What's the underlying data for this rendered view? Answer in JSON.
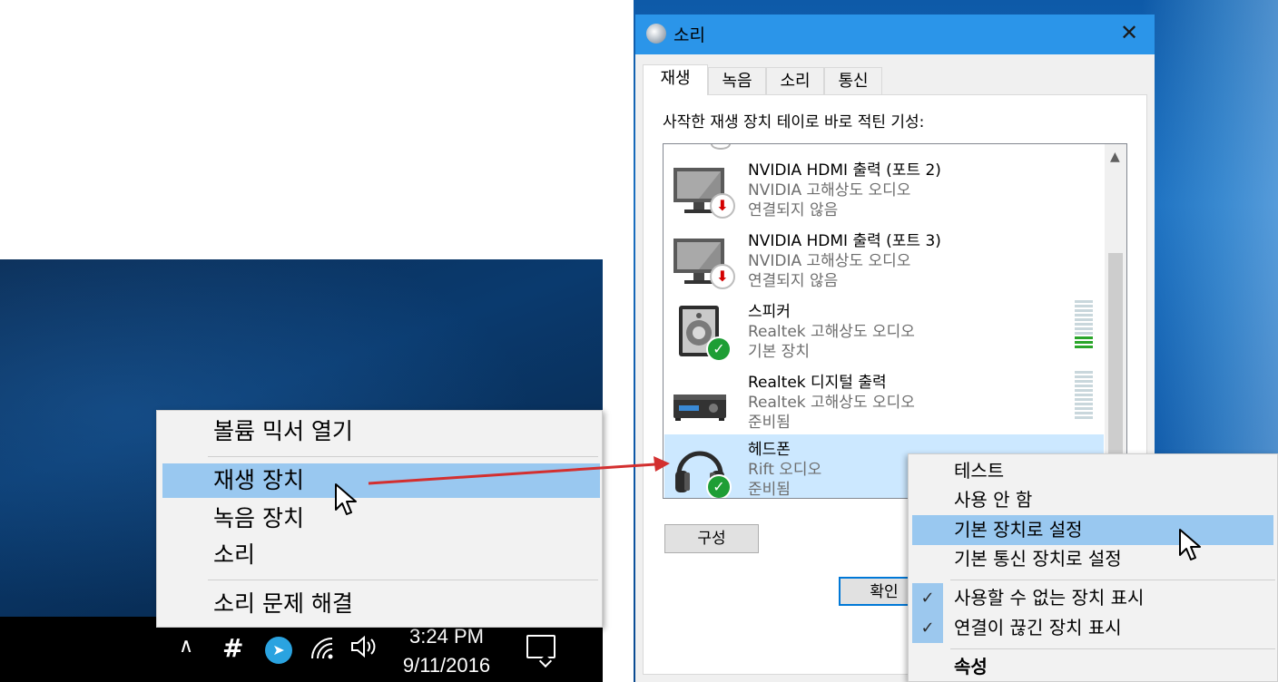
{
  "tray_menu": {
    "items": [
      {
        "label": "볼륨 믹서 열기"
      },
      {
        "label": "재생 장치"
      },
      {
        "label": "녹음 장치"
      },
      {
        "label": "소리"
      },
      {
        "label": "소리 문제 해결"
      }
    ],
    "highlighted_index": 1
  },
  "taskbar": {
    "time": "3:24 PM",
    "date": "9/11/2016",
    "icons": [
      "chevron-up-icon",
      "slack-icon",
      "telegram-icon",
      "wifi-icon",
      "volume-icon",
      "notification-icon"
    ]
  },
  "dialog": {
    "title": "소리",
    "close_glyph": "✕",
    "tabs": [
      {
        "label": "재생",
        "active": true
      },
      {
        "label": "녹음",
        "active": false
      },
      {
        "label": "소리",
        "active": false
      },
      {
        "label": "통신",
        "active": false
      }
    ],
    "instruction": "사작한 재생 장치 테이로 바로 적틴 기성:",
    "devices": [
      {
        "name": "NVIDIA HDMI 출력 (포트 2)",
        "driver": "NVIDIA 고해상도 오디오",
        "status": "연결되지 않음",
        "icon": "monitor-icon",
        "badge": "disconnected"
      },
      {
        "name": "NVIDIA HDMI 출력 (포트 3)",
        "driver": "NVIDIA 고해상도 오디오",
        "status": "연결되지 않음",
        "icon": "monitor-icon",
        "badge": "disconnected"
      },
      {
        "name": "스피커",
        "driver": "Realtek 고해상도 오디오",
        "status": "기본 장치",
        "icon": "speaker-icon",
        "badge": "default",
        "level": 0.25
      },
      {
        "name": "Realtek 디지털 출력",
        "driver": "Realtek 고해상도 오디오",
        "status": "준비됨",
        "icon": "receiver-icon",
        "badge": "none",
        "level": 0
      },
      {
        "name": "헤드폰",
        "driver": "Rift 오디오",
        "status": "준비됨",
        "icon": "headphones-icon",
        "badge": "default",
        "selected": true
      }
    ],
    "configure_button": "구성",
    "ok_button": "확인"
  },
  "device_menu": {
    "items": [
      {
        "label": "테스트",
        "checked": false
      },
      {
        "label": "사용 안 함",
        "checked": false
      },
      {
        "label": "기본 장치로 설정",
        "checked": false,
        "highlighted": true
      },
      {
        "label": "기본 통신 장치로 설정",
        "checked": false
      },
      {
        "label": "사용할 수 없는 장치 표시",
        "checked": true
      },
      {
        "label": "연결이 끊긴 장치 표시",
        "checked": true
      },
      {
        "label": "속성",
        "checked": false,
        "bold": true
      }
    ]
  },
  "colors": {
    "menu_highlight": "#99c8f0",
    "dialog_titlebar": "#2b95e9",
    "selected_device": "#cce8ff",
    "arrow": "#d32f2f",
    "badge_green": "#1e9e35",
    "level_green": "#2aa52a"
  }
}
